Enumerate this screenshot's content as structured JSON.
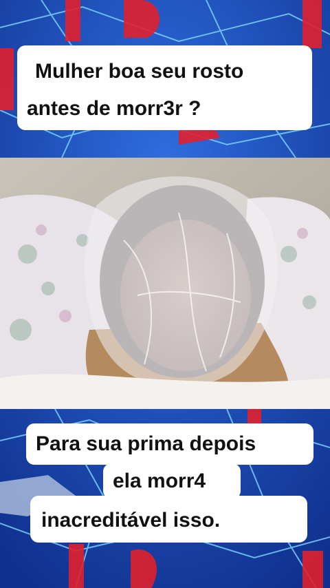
{
  "top_caption": {
    "line1": "Mulher boa seu rosto",
    "line2": "antes de morr3r ?"
  },
  "bottom_caption": {
    "line1": "Para sua prima depois",
    "line2": "ela morr4",
    "line3": "inacreditável isso."
  },
  "colors": {
    "background_blue": "#1d4fc4",
    "accent_red": "#e0202e",
    "network_lines": "#7fd8ff",
    "caption_bg": "#ffffff",
    "caption_text": "#111111"
  }
}
